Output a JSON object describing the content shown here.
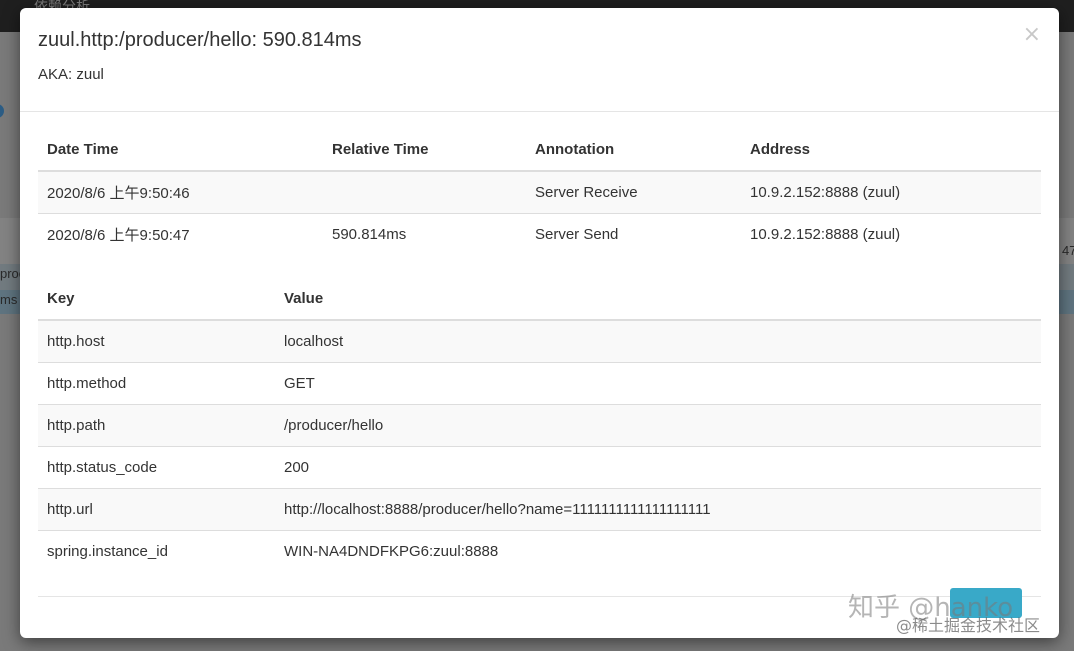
{
  "background": {
    "topbar_title": "依赖分析",
    "left_text_1": "proc",
    "left_text_2": "ms",
    "right_text": "47"
  },
  "modal": {
    "title": "zuul.http:/producer/hello: 590.814ms",
    "subtitle": "AKA: zuul",
    "close_label": "×"
  },
  "annotations": {
    "headers": [
      "Date Time",
      "Relative Time",
      "Annotation",
      "Address"
    ],
    "rows": [
      [
        "2020/8/6 上午9:50:46",
        "",
        "Server Receive",
        "10.9.2.152:8888 (zuul)"
      ],
      [
        "2020/8/6 上午9:50:47",
        "590.814ms",
        "Server Send",
        "10.9.2.152:8888 (zuul)"
      ]
    ]
  },
  "tags": {
    "headers": [
      "Key",
      "Value"
    ],
    "rows": [
      [
        "http.host",
        "localhost"
      ],
      [
        "http.method",
        "GET"
      ],
      [
        "http.path",
        "/producer/hello"
      ],
      [
        "http.status_code",
        "200"
      ],
      [
        "http.url",
        "http://localhost:8888/producer/hello?name=1111111111111111111"
      ],
      [
        "spring.instance_id",
        "WIN-NA4DNDFKPG6:zuul:8888"
      ]
    ]
  },
  "watermark": {
    "line1": "知乎 @hanko",
    "line2": "@稀土掘金技术社区"
  },
  "colors": {
    "footer_button": "#39a9c8",
    "table_stripe": "#f9f9f9",
    "border": "#dddddd"
  }
}
